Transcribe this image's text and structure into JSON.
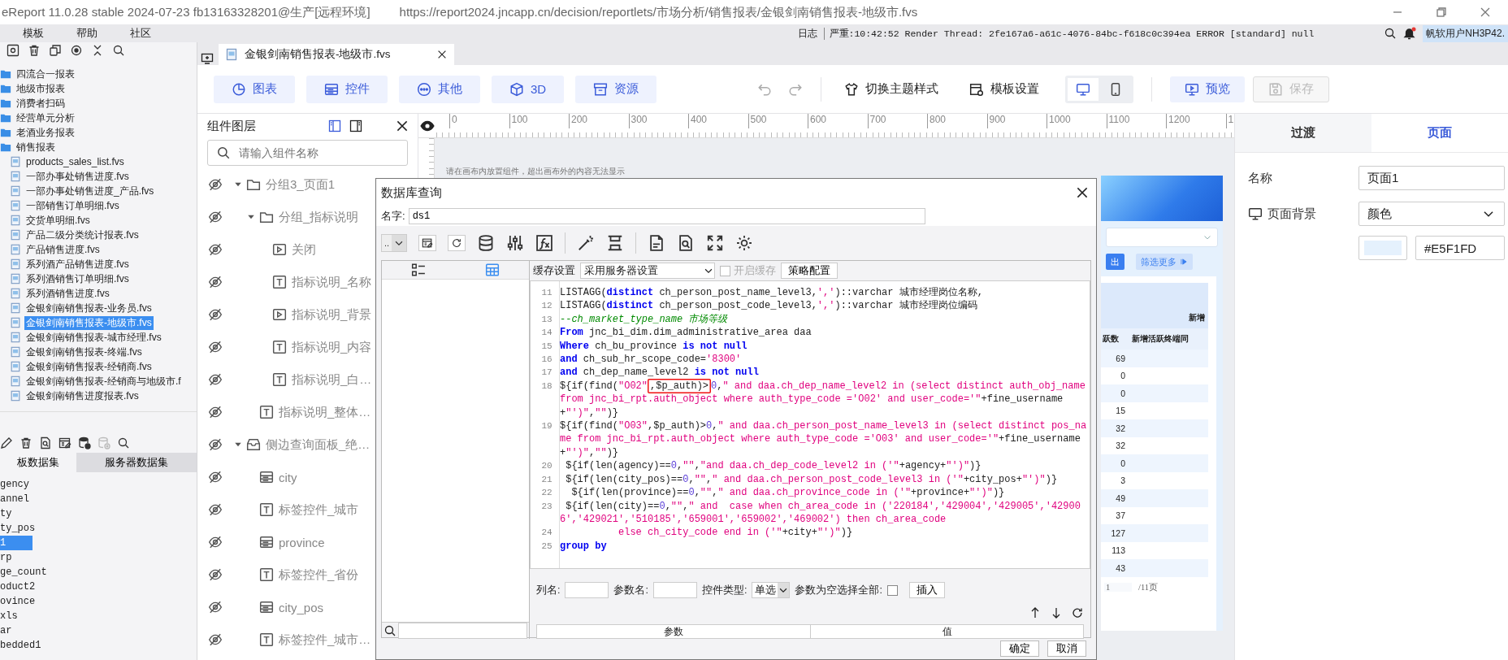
{
  "window": {
    "title": "eReport 11.0.28 stable 2024-07-23 fb13163328201@生产[远程环境]",
    "url": "https://report2024.jncapp.cn/decision/reportlets/市场分析/销售报表/金银剑南销售报表-地级市.fvs"
  },
  "menu": [
    "模板",
    "帮助",
    "社区"
  ],
  "status": {
    "log": "日志",
    "message": "严重:10:42:52 Render Thread: 2fe167a6-a61c-4076-84bc-f618c0c394ea ERROR [standard] null",
    "user": "帆软用户NH3P42."
  },
  "file_tree": [
    {
      "label": "四流合一报表",
      "kind": "folder",
      "selected": false
    },
    {
      "label": "地级市报表",
      "kind": "folder",
      "selected": false
    },
    {
      "label": "消费者扫码",
      "kind": "folder",
      "selected": false
    },
    {
      "label": "经营单元分析",
      "kind": "folder",
      "selected": false
    },
    {
      "label": "老酒业务报表",
      "kind": "folder",
      "selected": false
    },
    {
      "label": "销售报表",
      "kind": "folder",
      "selected": false,
      "children": [
        {
          "label": "products_sales_list.fvs",
          "kind": "file",
          "selected": false
        },
        {
          "label": "一部办事处销售进度.fvs",
          "kind": "file",
          "selected": false
        },
        {
          "label": "一部办事处销售进度_产品.fvs",
          "kind": "file",
          "selected": false
        },
        {
          "label": "一部销售订单明细.fvs",
          "kind": "file",
          "selected": false
        },
        {
          "label": "交货单明细.fvs",
          "kind": "file",
          "selected": false
        },
        {
          "label": "产品二级分类统计报表.fvs",
          "kind": "file",
          "selected": false
        },
        {
          "label": "产品销售进度.fvs",
          "kind": "file",
          "selected": false
        },
        {
          "label": "系列酒产品销售进度.fvs",
          "kind": "file",
          "selected": false
        },
        {
          "label": "系列酒销售订单明细.fvs",
          "kind": "file",
          "selected": false
        },
        {
          "label": "系列酒销售进度.fvs",
          "kind": "file",
          "selected": false
        },
        {
          "label": "金银剑南销售报表-业务员.fvs",
          "kind": "file",
          "selected": false
        },
        {
          "label": "金银剑南销售报表-地级市.fvs",
          "kind": "file",
          "selected": true
        },
        {
          "label": "金银剑南销售报表-城市经理.fvs",
          "kind": "file",
          "selected": false
        },
        {
          "label": "金银剑南销售报表-终端.fvs",
          "kind": "file",
          "selected": false
        },
        {
          "label": "金银剑南销售报表-经销商.fvs",
          "kind": "file",
          "selected": false
        },
        {
          "label": "金银剑南销售报表-经销商与地级市.f",
          "kind": "file",
          "selected": false
        },
        {
          "label": "金银剑南销售进度报表.fvs",
          "kind": "file",
          "selected": false
        }
      ]
    }
  ],
  "dataset_tabs": [
    {
      "label": "板数据集",
      "selected": true
    },
    {
      "label": "服务器数据集",
      "selected": false
    }
  ],
  "datasets": [
    {
      "label": "gency",
      "selected": false
    },
    {
      "label": "annel",
      "selected": false
    },
    {
      "label": "ty",
      "selected": false
    },
    {
      "label": "ty_pos",
      "selected": false
    },
    {
      "label": "1",
      "selected": true
    },
    {
      "label": "rp",
      "selected": false
    },
    {
      "label": "ge_count",
      "selected": false
    },
    {
      "label": "oduct2",
      "selected": false
    },
    {
      "label": "ovince",
      "selected": false
    },
    {
      "label": "xls",
      "selected": false
    },
    {
      "label": "ar",
      "selected": false
    },
    {
      "label": "bedded1",
      "selected": false
    }
  ],
  "document_tab": {
    "label": "金银剑南销售报表-地级市.fvs"
  },
  "toolbar": {
    "inserts": [
      {
        "kind": "chart",
        "label": "图表"
      },
      {
        "kind": "widget",
        "label": "控件"
      },
      {
        "kind": "more",
        "label": "其他"
      },
      {
        "kind": "cube",
        "label": "3D"
      },
      {
        "kind": "archive",
        "label": "资源"
      }
    ],
    "theme": "切换主题样式",
    "template_settings": "模板设置",
    "devices": [
      {
        "kind": "desktop",
        "selected": true
      },
      {
        "kind": "mobile",
        "selected": false
      }
    ],
    "preview": "预览",
    "save": {
      "label": "保存",
      "disabled": true
    }
  },
  "layers": {
    "title": "组件图层",
    "search_placeholder": "请输入组件名称",
    "items": [
      {
        "label": "分组3_页面1",
        "kind": "folder",
        "expanded": true,
        "children": [
          {
            "label": "分组_指标说明",
            "kind": "folder",
            "expanded": true,
            "children": [
              {
                "label": "关闭",
                "kind": "button"
              },
              {
                "label": "指标说明_名称",
                "kind": "text"
              },
              {
                "label": "指标说明_背景",
                "kind": "button"
              },
              {
                "label": "指标说明_内容",
                "kind": "text"
              },
              {
                "label": "指标说明_白…",
                "kind": "text"
              }
            ]
          },
          {
            "label": "指标说明_整体…",
            "kind": "text"
          }
        ]
      },
      {
        "label": "侧边查询面板_绝…",
        "kind": "panel",
        "expanded": true,
        "children": [
          {
            "label": "city",
            "kind": "widget"
          },
          {
            "label": "标签控件_城市",
            "kind": "text"
          },
          {
            "label": "province",
            "kind": "widget"
          },
          {
            "label": "标签控件_省份",
            "kind": "text"
          },
          {
            "label": "city_pos",
            "kind": "widget"
          },
          {
            "label": "标签控件_城市…",
            "kind": "text"
          }
        ]
      }
    ]
  },
  "canvas": {
    "ruler_labels": [
      "0",
      "100",
      "200",
      "300",
      "400",
      "500",
      "600",
      "700",
      "800",
      "900",
      "1000",
      "1100",
      "1200",
      "1"
    ],
    "hint": "请在画布内放置组件，超出画布外的内容无法显示",
    "query_button": "出",
    "more_button": "筛选更多",
    "table": {
      "group_header": "新增",
      "columns": [
        "跃数",
        "新增活跃终端同"
      ],
      "values": [
        "69",
        "0",
        "0",
        "15",
        "32",
        "32",
        "0",
        "3",
        "49",
        "37",
        "127",
        "113",
        "43"
      ]
    },
    "pager": {
      "page": "1",
      "total": "/11页"
    }
  },
  "properties": {
    "tabs": [
      {
        "label": "过渡",
        "selected": false
      },
      {
        "label": "页面",
        "selected": true
      }
    ],
    "name_label": "名称",
    "name_value": "页面1",
    "background_label": "页面背景",
    "background_type": "颜色",
    "color_hex": "#E5F1FD"
  },
  "dialog": {
    "title": "数据库查询",
    "name_label": "名字:",
    "name_value": "ds1",
    "connection": "..",
    "view_modes": [
      {
        "kind": "list",
        "selected": false
      },
      {
        "kind": "grid",
        "selected": true
      }
    ],
    "cache_label": "缓存设置",
    "cache_value": "采用服务器设置",
    "cache_toggle": {
      "label": "开启缓存",
      "checked": false,
      "disabled": true
    },
    "strategy_button": "策略配置",
    "code_lines": [
      {
        "number": "11",
        "segments": [
          {
            "kind": "plain",
            "text": "LISTAGG("
          },
          {
            "kind": "keyword",
            "text": "distinct"
          },
          {
            "kind": "plain",
            "text": " ch_person_post_name_level3,"
          },
          {
            "kind": "string",
            "text": "','"
          },
          {
            "kind": "plain",
            "text": ")::varchar 城市经理岗位名称,"
          }
        ]
      },
      {
        "number": "12",
        "segments": [
          {
            "kind": "plain",
            "text": "LISTAGG("
          },
          {
            "kind": "keyword",
            "text": "distinct"
          },
          {
            "kind": "plain",
            "text": " ch_person_post_code_level3,"
          },
          {
            "kind": "string",
            "text": "','"
          },
          {
            "kind": "plain",
            "text": ")::varchar 城市经理岗位编码"
          }
        ]
      },
      {
        "number": "13",
        "segments": [
          {
            "kind": "comment",
            "text": "--ch_market_type_name 市场等级"
          }
        ]
      },
      {
        "number": "14",
        "segments": [
          {
            "kind": "keyword",
            "text": "From"
          },
          {
            "kind": "plain",
            "text": " jnc_bi_dim.dim_administrative_area daa"
          }
        ]
      },
      {
        "number": "15",
        "segments": [
          {
            "kind": "keyword",
            "text": "Where"
          },
          {
            "kind": "plain",
            "text": " ch_bu_province "
          },
          {
            "kind": "keyword",
            "text": "is not null"
          }
        ]
      },
      {
        "number": "16",
        "segments": [
          {
            "kind": "keyword",
            "text": "and"
          },
          {
            "kind": "plain",
            "text": " ch_sub_hr_scope_code="
          },
          {
            "kind": "string",
            "text": "'8300'"
          }
        ]
      },
      {
        "number": "17",
        "segments": [
          {
            "kind": "keyword",
            "text": "and"
          },
          {
            "kind": "plain",
            "text": " ch_dep_name_level2 "
          },
          {
            "kind": "keyword",
            "text": "is not null"
          }
        ]
      },
      {
        "number": "18",
        "segments": [
          {
            "kind": "plain",
            "text": "${if(find("
          },
          {
            "kind": "string",
            "text": "\"O02\""
          },
          {
            "kind": "boxed",
            "text": ",$p_auth)>"
          },
          {
            "kind": "number",
            "text": "0"
          },
          {
            "kind": "plain",
            "text": ","
          },
          {
            "kind": "string",
            "text": "\" and daa.ch_dep_name_level2 in (select distinct auth_obj_name from jnc_bi_rpt.auth_object where auth_type_code ='O02' and user_code='\""
          },
          {
            "kind": "plain",
            "text": "+fine_username+"
          },
          {
            "kind": "string",
            "text": "\"')\""
          },
          {
            "kind": "plain",
            "text": ","
          },
          {
            "kind": "string",
            "text": "\"\""
          },
          {
            "kind": "plain",
            "text": ")}"
          }
        ]
      },
      {
        "number": "19",
        "segments": [
          {
            "kind": "plain",
            "text": "${if(find("
          },
          {
            "kind": "string",
            "text": "\"O03\""
          },
          {
            "kind": "plain",
            "text": ",$p_auth)>"
          },
          {
            "kind": "number",
            "text": "0"
          },
          {
            "kind": "plain",
            "text": ","
          },
          {
            "kind": "string",
            "text": "\" and daa.ch_person_post_name_level3 in (select distinct pos_name from jnc_bi_rpt.auth_object where auth_type_code ='O03' and user_code='\""
          },
          {
            "kind": "plain",
            "text": "+fine_username+"
          },
          {
            "kind": "string",
            "text": "\"')\""
          },
          {
            "kind": "plain",
            "text": ","
          },
          {
            "kind": "string",
            "text": "\"\""
          },
          {
            "kind": "plain",
            "text": ")}"
          }
        ]
      },
      {
        "number": "20",
        "segments": [
          {
            "kind": "plain",
            "text": " ${if(len(agency)=="
          },
          {
            "kind": "number",
            "text": "0"
          },
          {
            "kind": "plain",
            "text": ","
          },
          {
            "kind": "string",
            "text": "\"\""
          },
          {
            "kind": "plain",
            "text": ","
          },
          {
            "kind": "string",
            "text": "\"and daa.ch_dep_code_level2 in ('\""
          },
          {
            "kind": "plain",
            "text": "+agency+"
          },
          {
            "kind": "string",
            "text": "\"')\""
          },
          {
            "kind": "plain",
            "text": ")}"
          }
        ]
      },
      {
        "number": "21",
        "segments": [
          {
            "kind": "plain",
            "text": " ${if(len(city_pos)=="
          },
          {
            "kind": "number",
            "text": "0"
          },
          {
            "kind": "plain",
            "text": ","
          },
          {
            "kind": "string",
            "text": "\"\""
          },
          {
            "kind": "plain",
            "text": ","
          },
          {
            "kind": "string",
            "text": "\" and daa.ch_person_post_code_level3 in ('\""
          },
          {
            "kind": "plain",
            "text": "+city_pos+"
          },
          {
            "kind": "string",
            "text": "\"')\""
          },
          {
            "kind": "plain",
            "text": ")}"
          }
        ]
      },
      {
        "number": "22",
        "segments": [
          {
            "kind": "plain",
            "text": "  ${if(len(province)=="
          },
          {
            "kind": "number",
            "text": "0"
          },
          {
            "kind": "plain",
            "text": ","
          },
          {
            "kind": "string",
            "text": "\"\""
          },
          {
            "kind": "plain",
            "text": ","
          },
          {
            "kind": "string",
            "text": "\" and daa.ch_province_code in ('\""
          },
          {
            "kind": "plain",
            "text": "+province+"
          },
          {
            "kind": "string",
            "text": "\"')\""
          },
          {
            "kind": "plain",
            "text": ")}"
          }
        ]
      },
      {
        "number": "23",
        "segments": [
          {
            "kind": "plain",
            "text": " ${if(len(city)=="
          },
          {
            "kind": "number",
            "text": "0"
          },
          {
            "kind": "plain",
            "text": ","
          },
          {
            "kind": "string",
            "text": "\"\""
          },
          {
            "kind": "plain",
            "text": ","
          },
          {
            "kind": "string",
            "text": "\" and  case when ch_area_code in ('220184','429004','429005','429006','429021','510185','659001','659002','469002') then ch_area_code"
          }
        ]
      },
      {
        "number": "24",
        "segments": [
          {
            "kind": "string",
            "text": "          else ch_city_code end in ('\""
          },
          {
            "kind": "plain",
            "text": "+city+"
          },
          {
            "kind": "string",
            "text": "\"')\""
          },
          {
            "kind": "plain",
            "text": ")}"
          }
        ]
      },
      {
        "number": "25",
        "segments": [
          {
            "kind": "keyword",
            "text": "group by"
          }
        ]
      }
    ],
    "column_label": "列名:",
    "param_label": "参数名:",
    "control_type_label": "控件类型:",
    "control_type_value": "单选",
    "select_all_label": "参数为空选择全部:",
    "select_all_checked": false,
    "insert_button": "插入",
    "param_columns": [
      "参数",
      "值"
    ],
    "ok_button": "确定",
    "cancel_button": "取消"
  }
}
